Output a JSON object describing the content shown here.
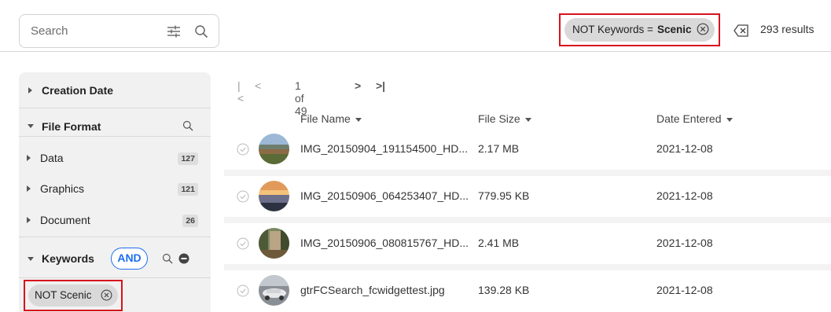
{
  "search": {
    "placeholder": "Search"
  },
  "active_filter": {
    "prefix": "NOT Keywords =",
    "value": "Scenic"
  },
  "results_text": "293 results",
  "facets": {
    "creation_date": "Creation Date",
    "file_format": "File Format",
    "formats": [
      {
        "label": "Data",
        "count": "127"
      },
      {
        "label": "Graphics",
        "count": "121"
      },
      {
        "label": "Document",
        "count": "26"
      }
    ],
    "keywords": "Keywords",
    "keywords_operator": "AND",
    "keyword_chip": "NOT Scenic"
  },
  "pager": {
    "first": "|<",
    "prev": "<",
    "page_text": "1 of 49",
    "next": ">",
    "last": ">|"
  },
  "columns": {
    "name": "File Name",
    "size": "File Size",
    "date": "Date Entered"
  },
  "files": [
    {
      "name": "IMG_20150904_191154500_HD...",
      "size": "2.17 MB",
      "date": "2021-12-08"
    },
    {
      "name": "IMG_20150906_064253407_HD...",
      "size": "779.95 KB",
      "date": "2021-12-08"
    },
    {
      "name": "IMG_20150906_080815767_HD...",
      "size": "2.41 MB",
      "date": "2021-12-08"
    },
    {
      "name": "gtrFCSearch_fcwidgettest.jpg",
      "size": "139.28 KB",
      "date": "2021-12-08"
    }
  ],
  "icons": {
    "search": "search-icon",
    "tune": "tune-icon",
    "remove_filter": "close-circle-icon",
    "clear_filters": "backspace-icon",
    "minus": "minus-circle-icon",
    "check": "check-circle-icon"
  }
}
